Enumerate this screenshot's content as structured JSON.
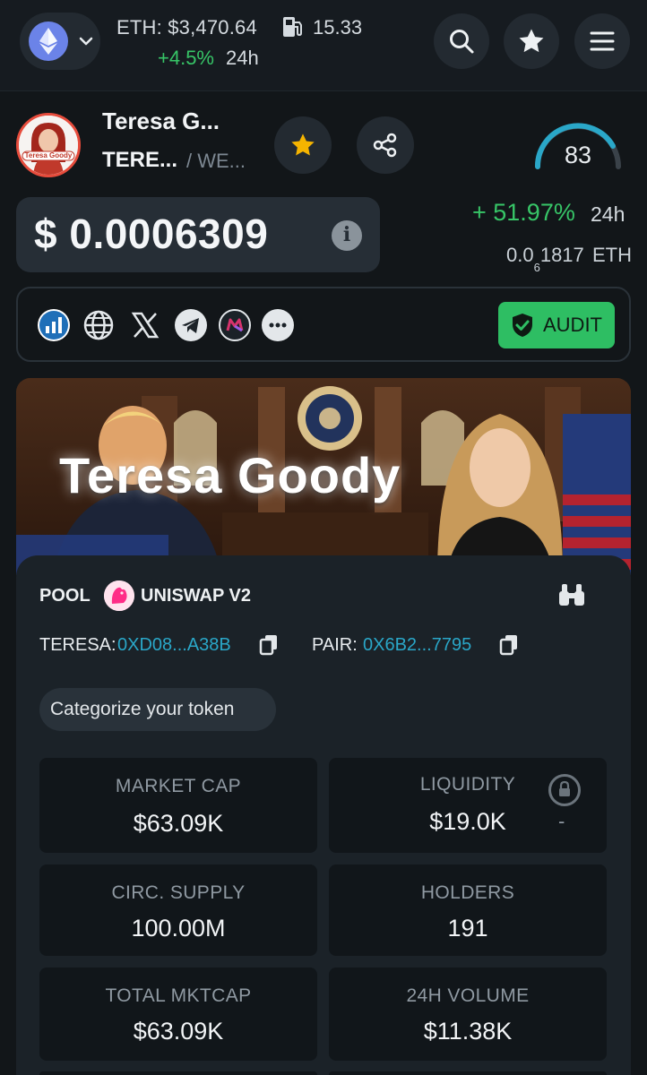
{
  "topbar": {
    "chain_icon": "ethereum-icon",
    "eth_price": "ETH: $3,470.64",
    "gas_value": "15.33",
    "eth_change": "+4.5%",
    "eth_change_period": "24h",
    "icons": [
      "search-icon",
      "star-icon",
      "menu-icon"
    ]
  },
  "token": {
    "name": "Teresa G...",
    "symbol": "TERE...",
    "base": "/ WE...",
    "avatar_text": "Teresa Goody",
    "score": "83",
    "price": "$ 0.0006309",
    "change_pct": "+ 51.97%",
    "change_period": "24h",
    "eth_value_prefix": "0.0",
    "eth_value_sub": "6",
    "eth_value_suffix": "1817",
    "eth_value_unit": "ETH"
  },
  "links": {
    "icons": [
      "chart-icon",
      "globe-icon",
      "x-icon",
      "telegram-icon",
      "m-icon",
      "more-icon"
    ],
    "audit_label": "AUDIT"
  },
  "banner": {
    "title": "Teresa Goody"
  },
  "pool": {
    "label": "POOL",
    "dex": "UNISWAP V2",
    "token_label": "TERESA:",
    "token_address": "0XD08...A38B",
    "pair_label": "PAIR:",
    "pair_address": "0X6B2...7795",
    "categorize": "Categorize your token"
  },
  "stats": [
    {
      "label": "MARKET CAP",
      "value": "$63.09K"
    },
    {
      "label": "LIQUIDITY",
      "value": "$19.0K",
      "extra": "-"
    },
    {
      "label": "CIRC. SUPPLY",
      "value": "100.00M"
    },
    {
      "label": "HOLDERS",
      "value": "191"
    },
    {
      "label": "TOTAL MKTCAP",
      "value": "$63.09K"
    },
    {
      "label": "24H VOLUME",
      "value": "$11.38K"
    }
  ],
  "colors": {
    "positive": "#37c567",
    "accent_link": "#2aa7c8",
    "audit": "#2ebe63",
    "favorite": "#f5b400",
    "gauge": "#2aa7c8"
  }
}
